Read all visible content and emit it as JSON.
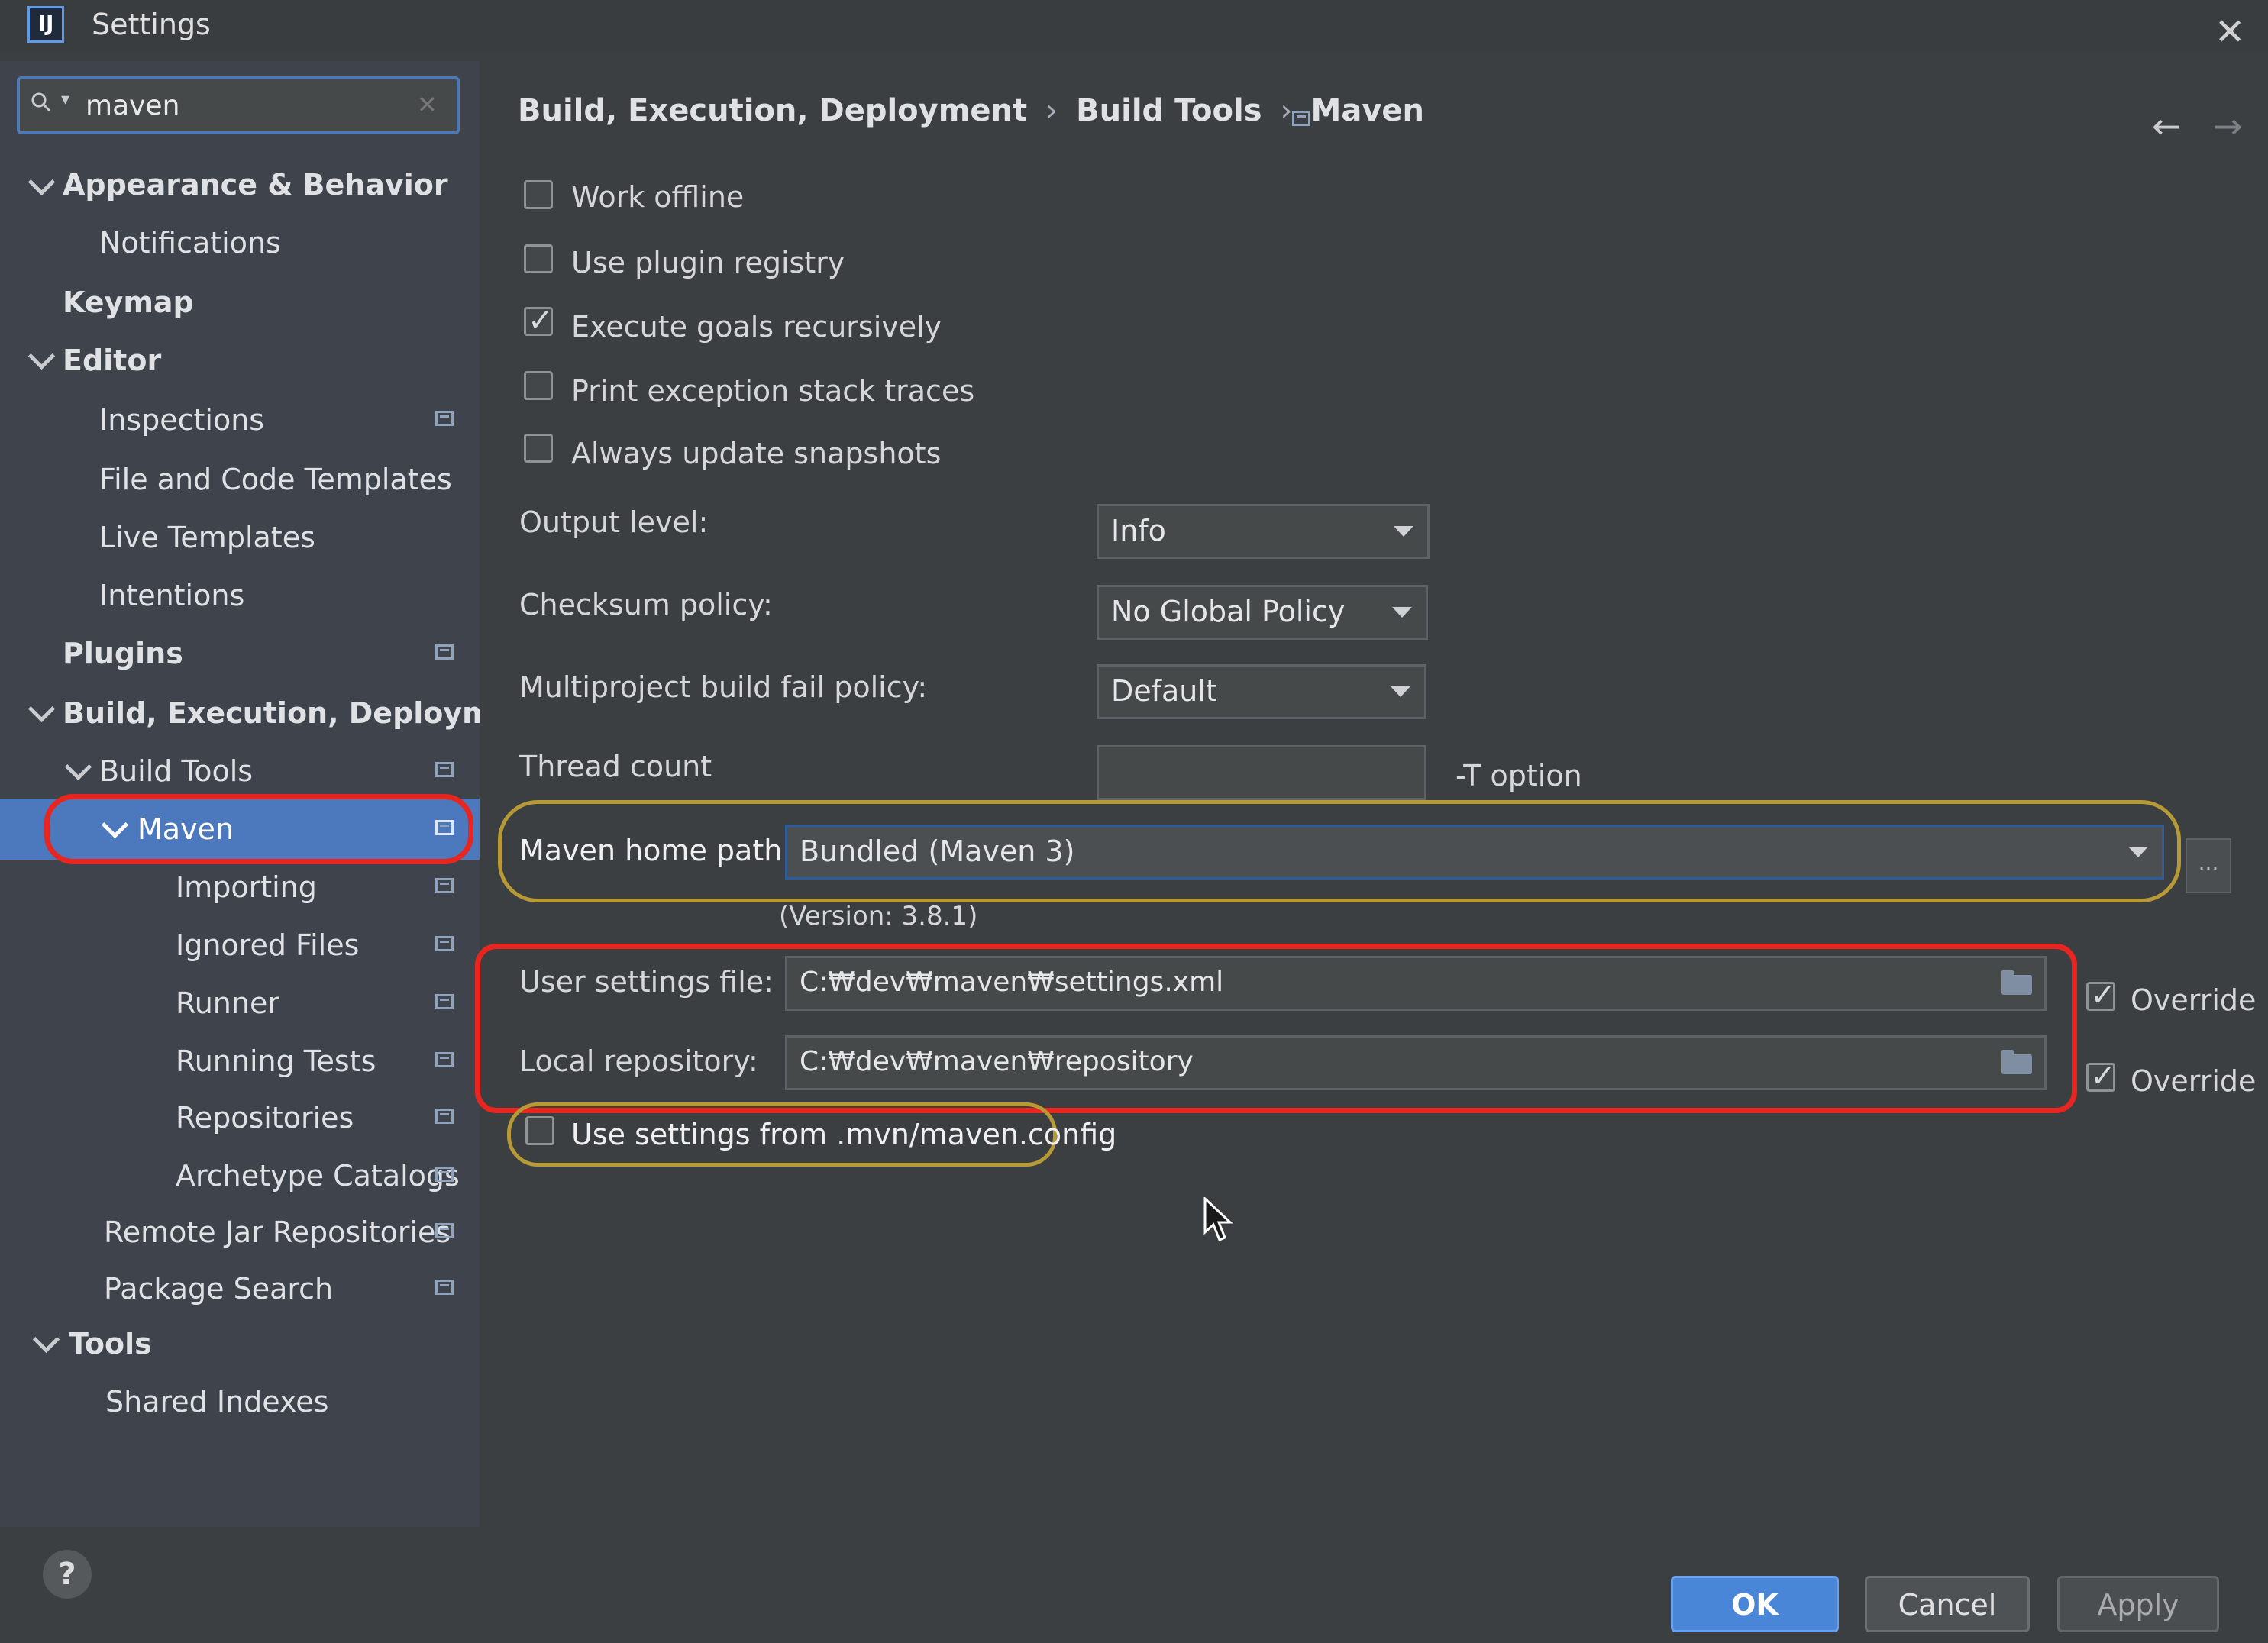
{
  "window": {
    "title": "Settings",
    "logo_text": "IJ"
  },
  "search": {
    "value": "maven"
  },
  "sidebar": {
    "items": [
      {
        "label": "Appearance & Behavior"
      },
      {
        "label": "Notifications"
      },
      {
        "label": "Keymap"
      },
      {
        "label": "Editor"
      },
      {
        "label": "Inspections"
      },
      {
        "label": "File and Code Templates"
      },
      {
        "label": "Live Templates"
      },
      {
        "label": "Intentions"
      },
      {
        "label": "Plugins"
      },
      {
        "label": "Build, Execution, Deployment"
      },
      {
        "label": "Build Tools"
      },
      {
        "label": "Maven"
      },
      {
        "label": "Importing"
      },
      {
        "label": "Ignored Files"
      },
      {
        "label": "Runner"
      },
      {
        "label": "Running Tests"
      },
      {
        "label": "Repositories"
      },
      {
        "label": "Archetype Catalogs"
      },
      {
        "label": "Remote Jar Repositories"
      },
      {
        "label": "Package Search"
      },
      {
        "label": "Tools"
      },
      {
        "label": "Shared Indexes"
      }
    ],
    "selected": "Maven"
  },
  "breadcrumb": {
    "items": [
      "Build, Execution, Deployment",
      "Build Tools",
      "Maven"
    ],
    "separator": "›"
  },
  "options": {
    "work_offline": {
      "label": "Work offline",
      "checked": false
    },
    "use_plugin_registry": {
      "label": "Use plugin registry",
      "checked": false
    },
    "execute_goals_recursively": {
      "label": "Execute goals recursively",
      "checked": true
    },
    "print_exception_stack_traces": {
      "label": "Print exception stack traces",
      "checked": false
    },
    "always_update_snapshots": {
      "label": "Always update snapshots",
      "checked": false
    }
  },
  "fields": {
    "output_level": {
      "label": "Output level:",
      "value": "Info"
    },
    "checksum_policy": {
      "label": "Checksum policy:",
      "value": "No Global Policy"
    },
    "multiproject_fail_policy": {
      "label": "Multiproject build fail policy:",
      "value": "Default"
    },
    "thread_count": {
      "label": "Thread count",
      "value": "",
      "suffix": "-T option"
    },
    "maven_home_path": {
      "label": "Maven home path:",
      "value": "Bundled (Maven 3)",
      "version": "(Version: 3.8.1)",
      "browse_label": "..."
    },
    "user_settings_file": {
      "label": "User settings file:",
      "value": "C:₩dev₩maven₩settings.xml",
      "override_label": "Override",
      "override_checked": true
    },
    "local_repository": {
      "label": "Local repository:",
      "value": "C:₩dev₩maven₩repository",
      "override_label": "Override",
      "override_checked": true
    },
    "use_mvn_config": {
      "label": "Use settings from .mvn/maven.config",
      "checked": false
    }
  },
  "footer": {
    "help_label": "?",
    "ok_label": "OK",
    "cancel_label": "Cancel",
    "apply_label": "Apply"
  },
  "colors": {
    "accent": "#4a86d8",
    "selection": "#4c79bd",
    "annotation_red": "#e8261f",
    "annotation_gold": "#b79a35",
    "background": "#3c3f41"
  }
}
